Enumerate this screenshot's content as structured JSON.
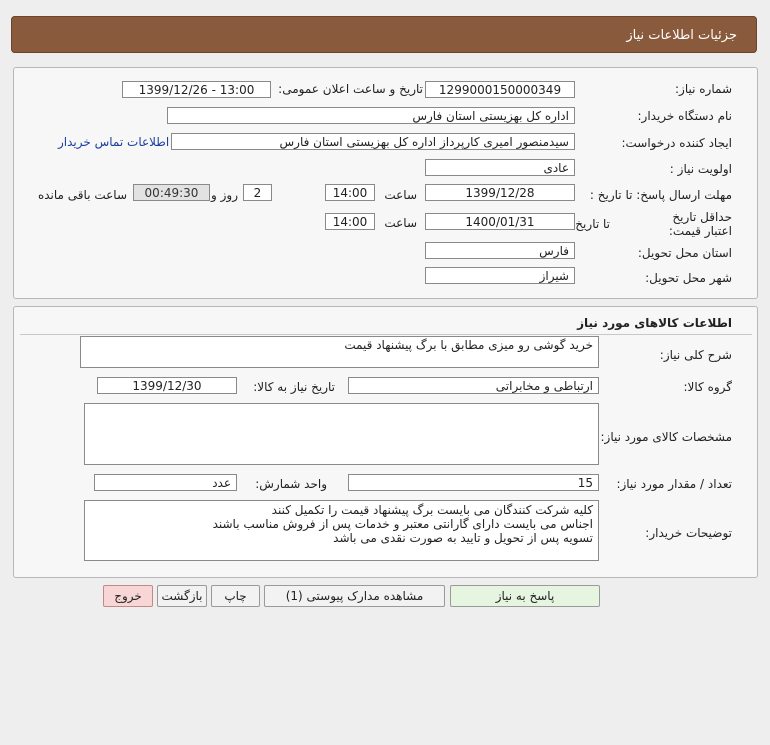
{
  "header": {
    "title": "جزئیات اطلاعات نیاز"
  },
  "info": {
    "need_number_label": "شماره نیاز:",
    "need_number": "1299000150000349",
    "announce_label": "تاریخ و ساعت اعلان عمومی:",
    "announce_value": "1399/12/26 - 13:00",
    "buyer_label": "نام دستگاه خریدار:",
    "buyer_value": "اداره کل بهزیستی استان فارس",
    "creator_label": "ایجاد کننده درخواست:",
    "creator_value": "سیدمنصور امیری کارپرداز اداره کل بهزیستی استان فارس",
    "contact_link": "اطلاعات تماس خریدار",
    "priority_label": "اولویت نیاز :",
    "priority_value": "عادی",
    "deadline_label": "مهلت ارسال پاسخ: تا تاریخ :",
    "deadline_date": "1399/12/28",
    "time_label": "ساعت",
    "deadline_time": "14:00",
    "days_value": "2",
    "days_label": "روز و",
    "remaining_time": "00:49:30",
    "remaining_label": "ساعت باقی مانده",
    "validity_label": "حداقل تاریخ اعتبار قیمت:",
    "validity_to_label": "تا تاریخ :",
    "validity_date": "1400/01/31",
    "validity_time_label": "ساعت",
    "validity_time": "14:00",
    "province_label": "استان محل تحویل:",
    "province_value": "فارس",
    "city_label": "شهر محل تحویل:",
    "city_value": "شیراز"
  },
  "goods": {
    "section_title": "اطلاعات کالاهای مورد نیاز",
    "desc_label": "شرح کلی نیاز:",
    "desc_value": "خرید گوشی رو میزی مطابق با برگ پیشنهاد قیمت",
    "group_label": "گروه کالا:",
    "group_value": "ارتباطی و مخابراتی",
    "need_date_label": "تاریخ نیاز به کالا:",
    "need_date_value": "1399/12/30",
    "specs_label": "مشخصات کالای مورد نیاز:",
    "specs_value": "",
    "qty_label": "تعداد / مقدار مورد نیاز:",
    "qty_value": "15",
    "unit_label": "واحد شمارش:",
    "unit_value": "عدد",
    "notes_label": "توضیحات خریدار:",
    "notes_value": "کلیه شرکت کنندگان می بایست برگ پیشنهاد قیمت را تکمیل کنند\nاجناس می بایست دارای گارانتی معتبر و خدمات پس از فروش مناسب باشند\nتسویه پس از تحویل  و تایید به صورت نقدی می باشد"
  },
  "buttons": {
    "reply": "پاسخ به نیاز",
    "attachments": "مشاهده مدارک پیوستی (1)",
    "print": "چاپ",
    "back": "بازگشت",
    "exit": "خروج"
  }
}
